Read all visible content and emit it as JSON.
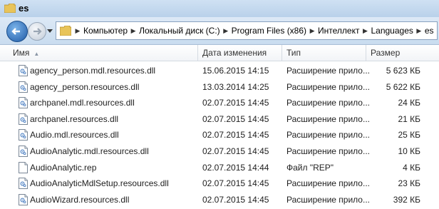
{
  "window": {
    "title": "es"
  },
  "nav": {
    "icons": [
      "back-arrow-icon",
      "forward-arrow-icon",
      "dropdown-icon",
      "folder-icon"
    ],
    "breadcrumb": [
      "Компьютер",
      "Локальный диск (C:)",
      "Program Files (x86)",
      "Интеллект",
      "Languages",
      "es"
    ]
  },
  "columns": {
    "name": "Имя",
    "date": "Дата изменения",
    "type": "Тип",
    "size": "Размер"
  },
  "files": [
    {
      "name": "agency_person.mdl.resources.dll",
      "date": "15.06.2015 14:15",
      "type": "Расширение прило...",
      "size": "5 623 КБ",
      "icon": "dll-file-icon"
    },
    {
      "name": "agency_person.resources.dll",
      "date": "13.03.2014 14:25",
      "type": "Расширение прило...",
      "size": "5 622 КБ",
      "icon": "dll-file-icon"
    },
    {
      "name": "archpanel.mdl.resources.dll",
      "date": "02.07.2015 14:45",
      "type": "Расширение прило...",
      "size": "24 КБ",
      "icon": "dll-file-icon"
    },
    {
      "name": "archpanel.resources.dll",
      "date": "02.07.2015 14:45",
      "type": "Расширение прило...",
      "size": "21 КБ",
      "icon": "dll-file-icon"
    },
    {
      "name": "Audio.mdl.resources.dll",
      "date": "02.07.2015 14:45",
      "type": "Расширение прило...",
      "size": "25 КБ",
      "icon": "dll-file-icon"
    },
    {
      "name": "AudioAnalytic.mdl.resources.dll",
      "date": "02.07.2015 14:45",
      "type": "Расширение прило...",
      "size": "10 КБ",
      "icon": "dll-file-icon"
    },
    {
      "name": "AudioAnalytic.rep",
      "date": "02.07.2015 14:44",
      "type": "Файл \"REP\"",
      "size": "4 КБ",
      "icon": "generic-file-icon"
    },
    {
      "name": "AudioAnalyticMdlSetup.resources.dll",
      "date": "02.07.2015 14:45",
      "type": "Расширение прило...",
      "size": "23 КБ",
      "icon": "dll-file-icon"
    },
    {
      "name": "AudioWizard.resources.dll",
      "date": "02.07.2015 14:45",
      "type": "Расширение прило...",
      "size": "392 КБ",
      "icon": "dll-file-icon"
    }
  ]
}
